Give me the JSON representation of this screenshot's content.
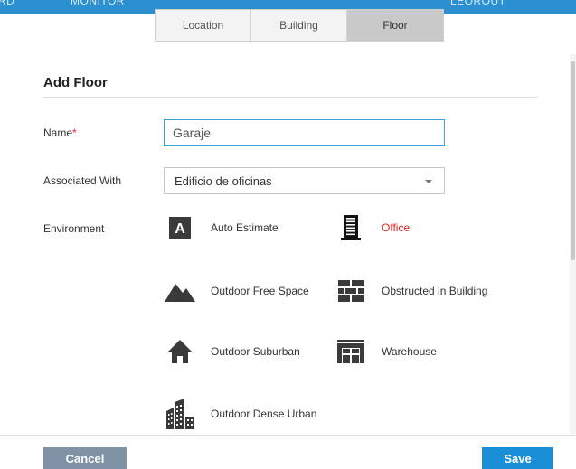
{
  "topbar": {
    "items": [
      "RD",
      "MONITOR",
      "LEOROUT"
    ]
  },
  "tabs": [
    {
      "label": "Location",
      "active": false
    },
    {
      "label": "Building",
      "active": false
    },
    {
      "label": "Floor",
      "active": true
    }
  ],
  "form": {
    "title": "Add Floor",
    "name_label": "Name",
    "required_mark": "*",
    "name_value": "Garaje",
    "associated_label": "Associated With",
    "associated_value": "Edificio de oficinas",
    "environment_label": "Environment"
  },
  "environments": [
    {
      "label": "Auto Estimate",
      "icon": "auto-estimate-icon",
      "selected": false
    },
    {
      "label": "Office",
      "icon": "office-building-icon",
      "selected": true
    },
    {
      "label": "Outdoor Free Space",
      "icon": "mountain-icon",
      "selected": false
    },
    {
      "label": "Obstructed in Building",
      "icon": "brick-wall-icon",
      "selected": false
    },
    {
      "label": "Outdoor Suburban",
      "icon": "house-icon",
      "selected": false
    },
    {
      "label": "Warehouse",
      "icon": "warehouse-icon",
      "selected": false
    },
    {
      "label": "Outdoor Dense Urban",
      "icon": "city-buildings-icon",
      "selected": false
    }
  ],
  "footer": {
    "cancel_label": "Cancel",
    "save_label": "Save"
  },
  "colors": {
    "topbar": "#2b8fd0",
    "input_focus": "#3aa3d8",
    "selected_text": "#e02020",
    "cancel_button": "#7f93a5",
    "save_button": "#1a8fd8",
    "icon": "#3a3a3a"
  }
}
